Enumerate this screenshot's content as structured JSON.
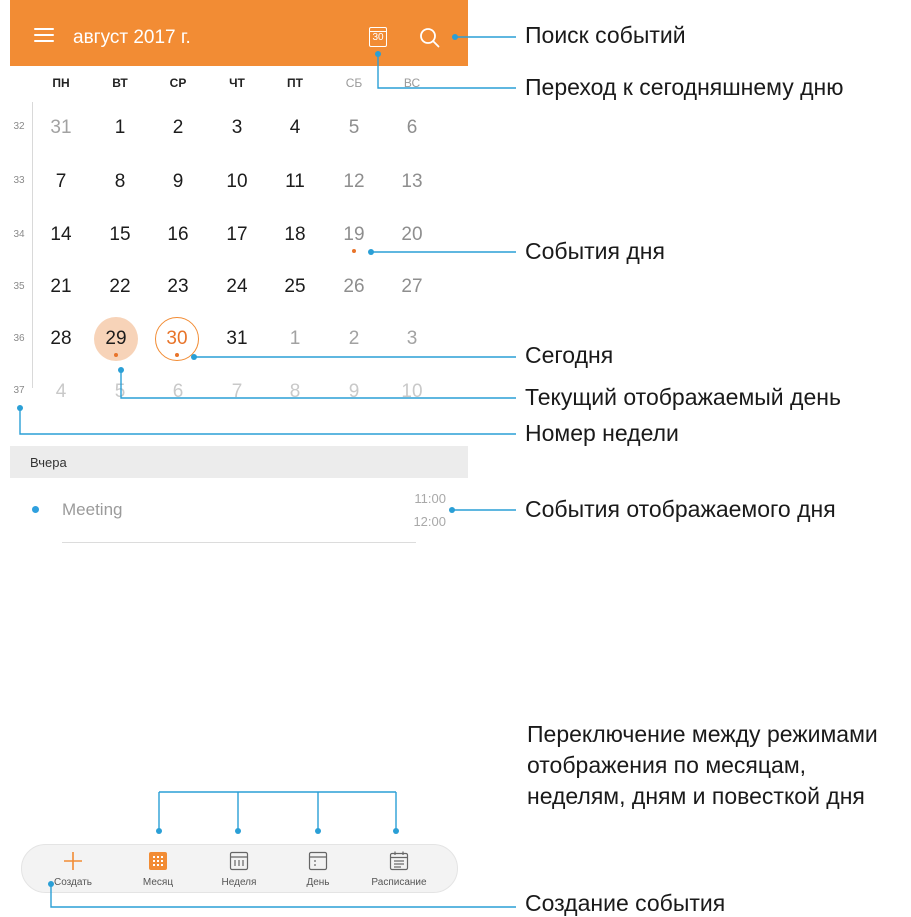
{
  "header": {
    "title": "август 2017 г.",
    "today_icon_label": "30"
  },
  "weekdays": [
    "ПН",
    "ВТ",
    "СР",
    "ЧТ",
    "ПТ",
    "СБ",
    "ВС"
  ],
  "weeks": [
    {
      "number": "32",
      "days": [
        "31",
        "1",
        "2",
        "3",
        "4",
        "5",
        "6"
      ]
    },
    {
      "number": "33",
      "days": [
        "7",
        "8",
        "9",
        "10",
        "11",
        "12",
        "13"
      ]
    },
    {
      "number": "34",
      "days": [
        "14",
        "15",
        "16",
        "17",
        "18",
        "19",
        "20"
      ]
    },
    {
      "number": "35",
      "days": [
        "21",
        "22",
        "23",
        "24",
        "25",
        "26",
        "27"
      ]
    },
    {
      "number": "36",
      "days": [
        "28",
        "29",
        "30",
        "31",
        "1",
        "2",
        "3"
      ]
    },
    {
      "number": "37",
      "days": [
        "4",
        "5",
        "6",
        "7",
        "8",
        "9",
        "10"
      ]
    }
  ],
  "selected_day": "29",
  "today": "30",
  "agenda": {
    "section_label": "Вчера",
    "events": [
      {
        "title": "Meeting",
        "start": "11:00",
        "end": "12:00"
      }
    ]
  },
  "bottom_nav": [
    {
      "label": "Создать",
      "icon": "plus-icon"
    },
    {
      "label": "Месяц",
      "icon": "month-view-icon"
    },
    {
      "label": "Неделя",
      "icon": "week-view-icon"
    },
    {
      "label": "День",
      "icon": "day-view-icon"
    },
    {
      "label": "Расписание",
      "icon": "agenda-view-icon"
    }
  ],
  "annotations": {
    "search": "Поиск событий",
    "goto_today": "Переход к сегодняшнему дню",
    "day_events": "События дня",
    "today": "Сегодня",
    "current_day": "Текущий отображаемый день",
    "week_number": "Номер недели",
    "displayed_day_events": "События отображаемого дня",
    "view_switch": "Переключение между режимами отображения по месяцам, неделям, дням и повесткой дня",
    "create_event": "Создание события"
  },
  "colors": {
    "accent": "#f28c34",
    "selected_fill": "#f7d3b8",
    "event_dot": "#e8742a",
    "agenda_dot": "#2fa0de"
  }
}
